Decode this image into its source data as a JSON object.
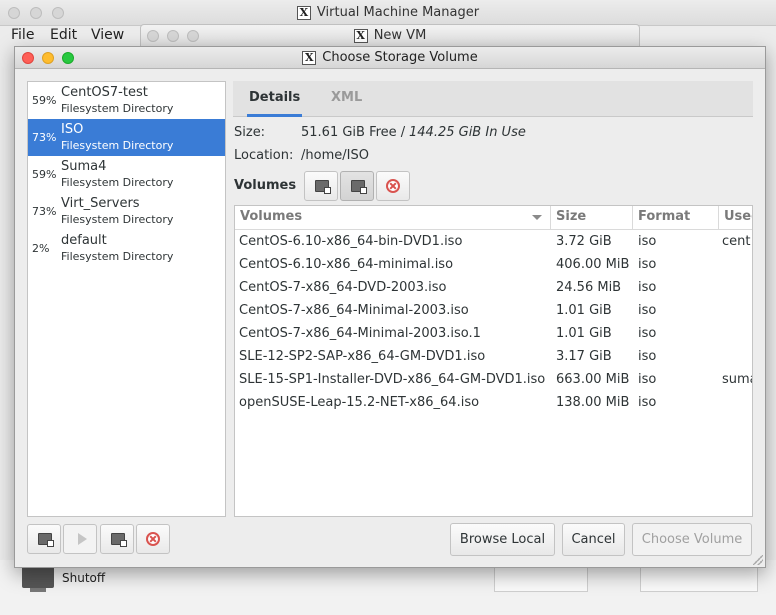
{
  "vmm": {
    "title": "Virtual Machine Manager",
    "menu": [
      "File",
      "Edit",
      "View"
    ],
    "status": "Shutoff"
  },
  "newvm": {
    "title": "New VM"
  },
  "dialog": {
    "title": "Choose Storage Volume",
    "pools": [
      {
        "pct": "59%",
        "name": "CentOS7-test",
        "type": "Filesystem Directory",
        "selected": false
      },
      {
        "pct": "73%",
        "name": "ISO",
        "type": "Filesystem Directory",
        "selected": true
      },
      {
        "pct": "59%",
        "name": "Suma4",
        "type": "Filesystem Directory",
        "selected": false
      },
      {
        "pct": "73%",
        "name": "Virt_Servers",
        "type": "Filesystem Directory",
        "selected": false
      },
      {
        "pct": "2%",
        "name": "default",
        "type": "Filesystem Directory",
        "selected": false
      }
    ],
    "tabs": {
      "details": "Details",
      "xml": "XML"
    },
    "details": {
      "size_label": "Size:",
      "size_free": "51.61 GiB Free /",
      "size_inuse": "144.25 GiB In Use",
      "location_label": "Location:",
      "location_value": "/home/ISO",
      "volumes_label": "Volumes"
    },
    "table": {
      "columns": [
        "Volumes",
        "Size",
        "Format",
        "Used By"
      ],
      "rows": [
        {
          "name": "CentOS-6.10-x86_64-bin-DVD1.iso",
          "size": "3.72 GiB",
          "format": "iso",
          "used": "cent"
        },
        {
          "name": "CentOS-6.10-x86_64-minimal.iso",
          "size": "406.00 MiB",
          "format": "iso",
          "used": ""
        },
        {
          "name": "CentOS-7-x86_64-DVD-2003.iso",
          "size": "24.56 MiB",
          "format": "iso",
          "used": ""
        },
        {
          "name": "CentOS-7-x86_64-Minimal-2003.iso",
          "size": "1.01 GiB",
          "format": "iso",
          "used": ""
        },
        {
          "name": "CentOS-7-x86_64-Minimal-2003.iso.1",
          "size": "1.01 GiB",
          "format": "iso",
          "used": ""
        },
        {
          "name": "SLE-12-SP2-SAP-x86_64-GM-DVD1.iso",
          "size": "3.17 GiB",
          "format": "iso",
          "used": ""
        },
        {
          "name": "SLE-15-SP1-Installer-DVD-x86_64-GM-DVD1.iso",
          "size": "663.00 MiB",
          "format": "iso",
          "used": "suma"
        },
        {
          "name": "openSUSE-Leap-15.2-NET-x86_64.iso",
          "size": "138.00 MiB",
          "format": "iso",
          "used": ""
        }
      ]
    },
    "buttons": {
      "browse_local": "Browse Local",
      "cancel": "Cancel",
      "choose_volume": "Choose Volume"
    }
  }
}
